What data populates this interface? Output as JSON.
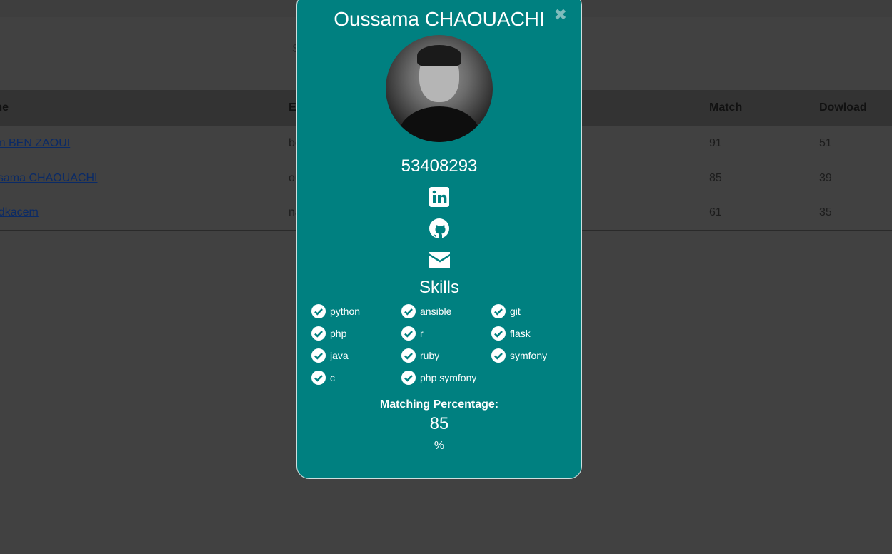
{
  "search_hint": "S",
  "table": {
    "headers": [
      "ame",
      "E",
      "Match",
      "Dowload"
    ],
    "rows": [
      {
        "name": "rem BEN ZAOUI",
        "email": "be",
        "match": "91",
        "download": "51"
      },
      {
        "name": "ussama CHAOUACHI",
        "email": "ou",
        "match": "85",
        "download": "39"
      },
      {
        "name": "hedkacem",
        "email": "na",
        "match": "61",
        "download": "35"
      }
    ]
  },
  "modal": {
    "name": "Oussama CHAOUACHI",
    "phone": "53408293",
    "skills_title": "Skills",
    "skills": [
      "python",
      "ansible",
      "git",
      "php",
      "r",
      "flask",
      "java",
      "ruby",
      "symfony",
      "c",
      "php symfony"
    ],
    "matching_label": "Matching Percentage:",
    "matching_value": "85",
    "matching_unit": "%",
    "accent": "#008080"
  }
}
